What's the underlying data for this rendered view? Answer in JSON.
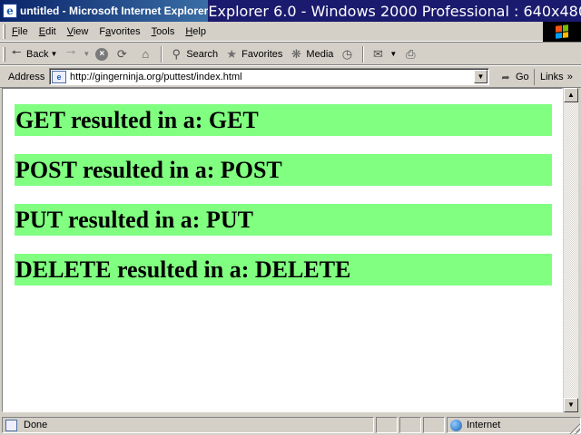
{
  "window": {
    "title": "untitled - Microsoft Internet Explorer",
    "banner": "Explorer 6.0 - Windows 2000 Professional : 640x480"
  },
  "menu": {
    "items": [
      {
        "accel": "F",
        "rest": "ile"
      },
      {
        "accel": "E",
        "rest": "dit"
      },
      {
        "accel": "V",
        "rest": "iew"
      },
      {
        "pre": "F",
        "accel": "a",
        "rest": "vorites"
      },
      {
        "accel": "T",
        "rest": "ools"
      },
      {
        "accel": "H",
        "rest": "elp"
      }
    ]
  },
  "toolbar": {
    "back_label": "Back",
    "search_label": "Search",
    "favorites_label": "Favorites",
    "media_label": "Media"
  },
  "address": {
    "label": "Address",
    "url": "http://gingerninja.org/puttest/index.html",
    "go_label": "Go",
    "links_label": "Links"
  },
  "content": {
    "results": [
      "GET resulted in a: GET",
      "POST resulted in a: POST",
      "PUT resulted in a: PUT",
      "DELETE resulted in a: DELETE"
    ],
    "row_color": "#80ff80"
  },
  "status": {
    "text": "Done",
    "zone": "Internet"
  },
  "colors": {
    "titlebar": "#0a246a",
    "chrome": "#d4d0c8"
  }
}
